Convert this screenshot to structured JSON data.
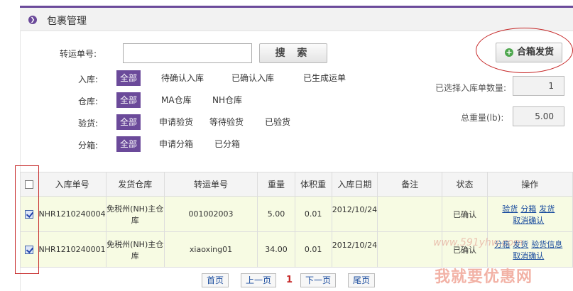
{
  "header": {
    "title": "包裹管理"
  },
  "search": {
    "label": "转运单号:",
    "value": "",
    "button": "搜 索"
  },
  "filters": {
    "inbound": {
      "label": "入库:",
      "options": [
        "全部",
        "待确认入库",
        "已确认入库",
        "已生成运单"
      ]
    },
    "warehouse": {
      "label": "仓库:",
      "options": [
        "全部",
        "MA仓库",
        "NH仓库"
      ]
    },
    "inspect": {
      "label": "验货:",
      "options": [
        "全部",
        "申请验货",
        "等待验货",
        "已验货"
      ]
    },
    "split": {
      "label": "分箱:",
      "options": [
        "全部",
        "申请分箱",
        "已分箱"
      ]
    }
  },
  "merge_ship_button": "合箱发货",
  "summary": {
    "selected_label": "已选择入库单数量:",
    "selected_value": "1",
    "weight_label": "总重量(lb):",
    "weight_value": "5.00"
  },
  "table": {
    "headers": [
      "入库单号",
      "发货仓库",
      "转运单号",
      "重量",
      "体积重",
      "入库日期",
      "备注",
      "状态",
      "操作"
    ],
    "rows": [
      {
        "checked": true,
        "inbound_no": "NHR1210240004",
        "warehouse": "免税州(NH)主仓库",
        "tracking": "001002003",
        "weight": "5.00",
        "vol_weight": "0.01",
        "date": "2012/10/24",
        "note": "",
        "status": "已确认",
        "actions": [
          "验货",
          "分箱",
          "发货",
          "取消确认"
        ]
      },
      {
        "checked": true,
        "inbound_no": "NHR1210240001",
        "warehouse": "免税州(NH)主仓库",
        "tracking": "xiaoxing01",
        "weight": "34.00",
        "vol_weight": "0.01",
        "date": "2012/10/24",
        "note": "",
        "status": "已确认",
        "actions": [
          "分箱",
          "发货",
          "验货信息",
          "取消确认"
        ]
      }
    ]
  },
  "pagination": {
    "first": "首页",
    "prev": "上一页",
    "current": "1",
    "next": "下一页",
    "last": "尾页"
  },
  "watermark": {
    "url": "www.591yhw.com",
    "text": "我就要优惠网"
  },
  "colors": {
    "accent": "#6b4a9a",
    "row_bg": "#f7fbe3",
    "annotation_red": "#c62828",
    "link": "#1a4c9e"
  }
}
